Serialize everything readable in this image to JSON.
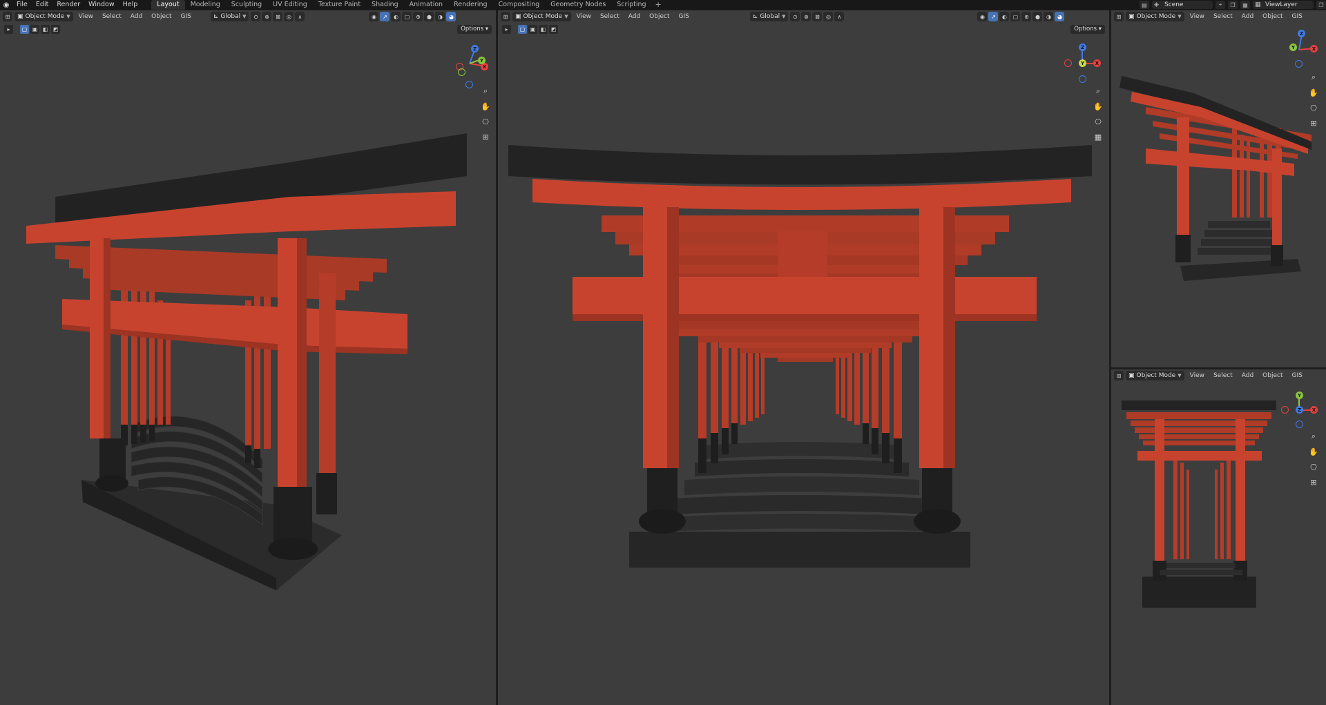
{
  "app": {
    "menus": [
      "File",
      "Edit",
      "Render",
      "Window",
      "Help"
    ],
    "workspaces": [
      "Layout",
      "Modeling",
      "Sculpting",
      "UV Editing",
      "Texture Paint",
      "Shading",
      "Animation",
      "Rendering",
      "Compositing",
      "Geometry Nodes",
      "Scripting"
    ],
    "active_workspace": "Layout",
    "add_workspace": "+",
    "scene": "Scene",
    "view_layer": "ViewLayer"
  },
  "viewports": {
    "left": {
      "mode": "Object Mode",
      "menus": [
        "View",
        "Select",
        "Add",
        "Object",
        "GIS"
      ],
      "orientation": "Global",
      "options": "Options"
    },
    "center": {
      "mode": "Object Mode",
      "menus": [
        "View",
        "Select",
        "Add",
        "Object",
        "GIS"
      ],
      "orientation": "Global",
      "options": "Options"
    },
    "top_right": {
      "mode": "Object Mode",
      "menus": [
        "View",
        "Select",
        "Add",
        "Object",
        "GIS"
      ]
    },
    "bottom_right": {
      "mode": "Object Mode",
      "menus": [
        "View",
        "Select",
        "Add",
        "Object",
        "GIS"
      ]
    }
  },
  "gizmo_axes": {
    "x": "X",
    "y": "Y",
    "z": "Z"
  },
  "colors": {
    "viewport_bg": "#3d3d3d",
    "torii_red": "#c8432e",
    "torii_black": "#222222",
    "axis_x": "#e8403f",
    "axis_y": "#8cc63f",
    "axis_z": "#3f7be8"
  },
  "icons": [
    "blender-logo",
    "zoom-icon",
    "hand-pan-icon",
    "camera-icon",
    "grid-icon"
  ]
}
